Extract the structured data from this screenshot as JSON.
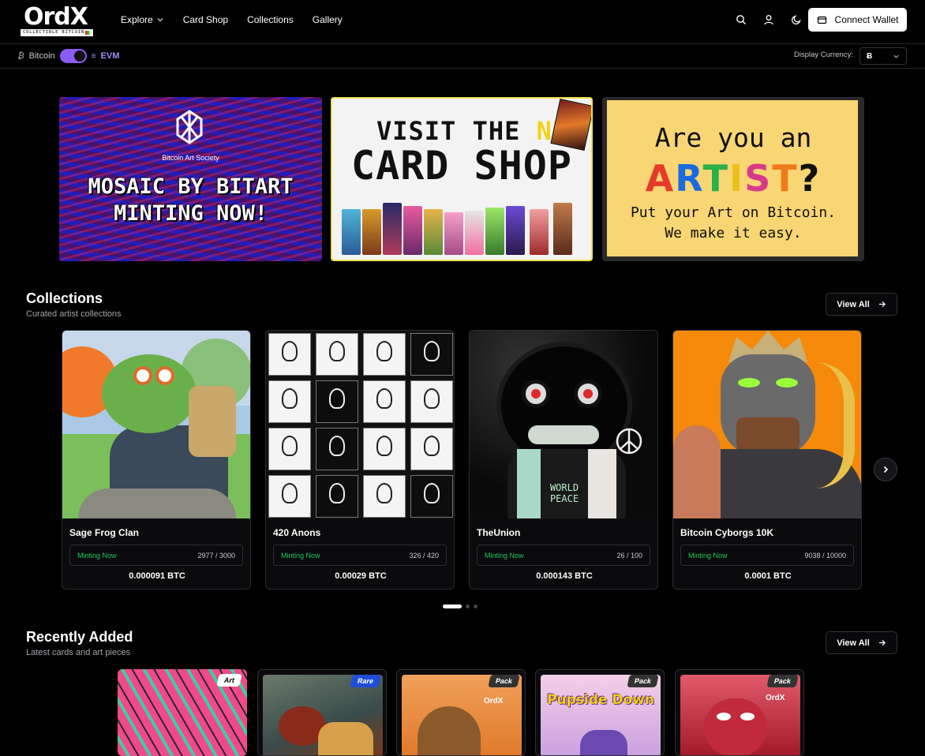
{
  "nav": {
    "logo_text": "OrdX",
    "logo_tagline": "COLLECTIBLE BITCOIN",
    "menu": [
      {
        "label": "Explore",
        "icon": "chevron-down-icon"
      },
      {
        "label": "Card Shop"
      },
      {
        "label": "Collections"
      },
      {
        "label": "Gallery"
      }
    ],
    "icons": [
      "search-icon",
      "user-icon",
      "moon-icon"
    ],
    "connect_label": "Connect Wallet"
  },
  "subbar": {
    "bitcoin_label": "Bitcoin",
    "evm_label": "EVM",
    "toggle_on": true,
    "currency_label": "Display Currency:",
    "currency_value": "Ƀ"
  },
  "banners": {
    "mosaic": {
      "society": "Bitcoin Art Society",
      "line1": "MOSAIC BY BITART",
      "line2": "MINTING NOW!"
    },
    "cardshop": {
      "visit": "VISIT THE ",
      "new": "NEW",
      "title": "CARD SHOP"
    },
    "artist": {
      "question": "Are you an",
      "art_letters": [
        "A",
        "R",
        "T",
        "I",
        "S",
        "T"
      ],
      "qmark": "?",
      "line1": "Put your Art on Bitcoin.",
      "line2": "We make it easy."
    }
  },
  "collections": {
    "title": "Collections",
    "subtitle": "Curated artist collections",
    "view_all": "View All",
    "items": [
      {
        "name": "Sage Frog Clan",
        "status": "Minting Now",
        "count": "2977 / 3000",
        "price": "0.000091 BTC",
        "minted_fraction": 0.992
      },
      {
        "name": "420 Anons",
        "status": "Minting Now",
        "count": "326 / 420",
        "price": "0.00029 BTC",
        "minted_fraction": 0.776
      },
      {
        "name": "TheUnion",
        "status": "Minting Now",
        "count": "26 / 100",
        "price": "0.000143 BTC",
        "minted_fraction": 0.26
      },
      {
        "name": "Bitcoin Cyborgs 10K",
        "status": "Minting Now",
        "count": "9038 / 10000",
        "price": "0.0001 BTC",
        "minted_fraction": 0.904
      }
    ],
    "world_peace_1": "WORLD",
    "world_peace_2": "PEACE"
  },
  "recent": {
    "title": "Recently Added",
    "subtitle": "Latest cards and art pieces",
    "view_all": "View All",
    "items": [
      {
        "badge": "Art",
        "badge_color": "#ffffff",
        "badge_text_color": "#000000"
      },
      {
        "badge": "Rare",
        "badge_color": "#1d4ed8",
        "badge_text_color": "#ffffff"
      },
      {
        "badge": "Pack",
        "badge_color": "#333333",
        "badge_text_color": "#ffffff",
        "label": "OrdX"
      },
      {
        "badge": "Pack",
        "badge_color": "#333333",
        "badge_text_color": "#ffffff",
        "label": "Pupside Down"
      },
      {
        "badge": "Pack",
        "badge_color": "#333333",
        "badge_text_color": "#ffffff",
        "label": "OrdX"
      }
    ]
  },
  "carousel": {
    "pages": 3,
    "active": 0
  },
  "colors": {
    "accent": "#8b5cf6",
    "minting": "#22c55e",
    "background": "#000000"
  }
}
